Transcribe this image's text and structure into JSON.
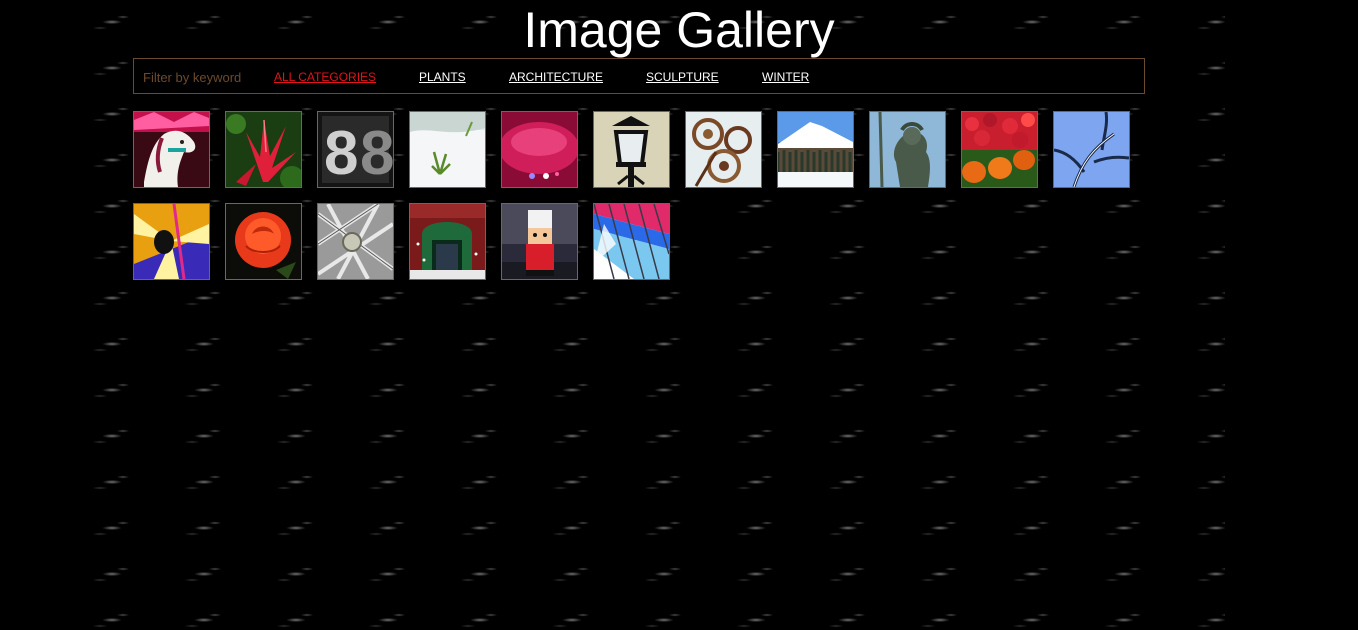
{
  "page": {
    "title": "Image Gallery"
  },
  "filter": {
    "placeholder": "Filter by keyword",
    "categories": [
      {
        "label": "ALL CATEGORIES",
        "active": true
      },
      {
        "label": "PLANTS",
        "active": false
      },
      {
        "label": "ARCHITECTURE",
        "active": false
      },
      {
        "label": "SCULPTURE",
        "active": false
      },
      {
        "label": "WINTER",
        "active": false
      }
    ]
  },
  "colors": {
    "active_category": "#e0141a",
    "category": "#ffffff",
    "filter_border": "#6b4a2e",
    "thumb_border": "#6a52d6"
  },
  "thumbnails": [
    {
      "subject": "carousel-horse"
    },
    {
      "subject": "red-bromeliad"
    },
    {
      "subject": "number-eight-sign"
    },
    {
      "subject": "snow-plant"
    },
    {
      "subject": "pink-lights"
    },
    {
      "subject": "street-lamp"
    },
    {
      "subject": "metal-flower-sculpture"
    },
    {
      "subject": "snowy-mountain"
    },
    {
      "subject": "neptune-statue"
    },
    {
      "subject": "pumpkins-and-mums"
    },
    {
      "subject": "snowy-branches"
    },
    {
      "subject": "light-burst"
    },
    {
      "subject": "red-rose"
    },
    {
      "subject": "steel-truss-ornament"
    },
    {
      "subject": "storefront-in-snow"
    },
    {
      "subject": "nutcracker"
    },
    {
      "subject": "color-glass-ceiling"
    }
  ]
}
